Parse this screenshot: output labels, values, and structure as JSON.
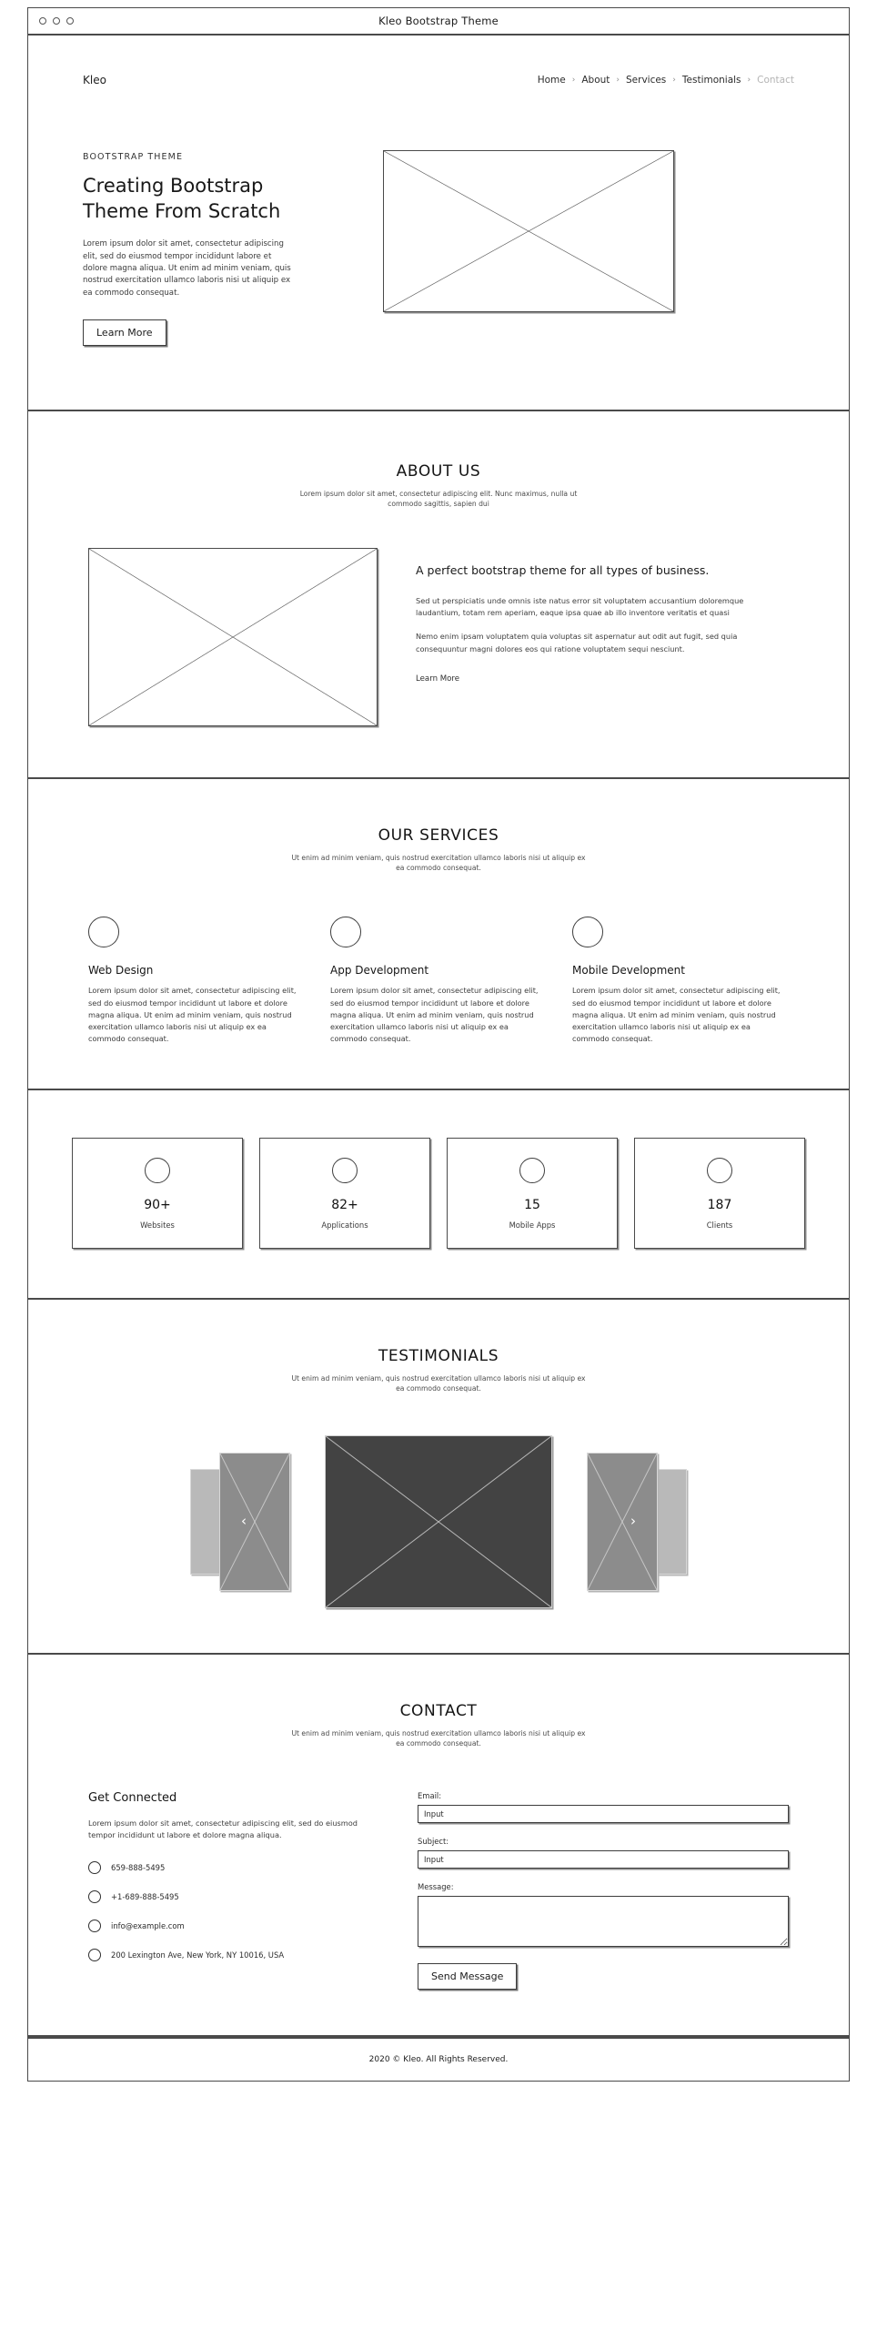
{
  "window": {
    "title": "Kleo Bootstrap Theme",
    "traffic_lights": [
      "close-dot",
      "minimize-dot",
      "maximize-dot"
    ]
  },
  "navbar": {
    "brand": "Kleo",
    "separator": "›",
    "links": [
      {
        "label": "Home",
        "muted": false
      },
      {
        "label": "About",
        "muted": false
      },
      {
        "label": "Services",
        "muted": false
      },
      {
        "label": "Testimonials",
        "muted": false
      },
      {
        "label": "Contact",
        "muted": true
      }
    ]
  },
  "hero": {
    "eyebrow": "BOOTSTRAP THEME",
    "title_line1": "Creating Bootstrap",
    "title_line2": "Theme From Scratch",
    "body": "Lorem ipsum dolor sit amet, consectetur adipiscing elit, sed do eiusmod tempor incididunt labore et dolore magna aliqua. Ut enim ad minim veniam, quis nostrud exercitation ullamco laboris nisi ut aliquip ex ea commodo consequat.",
    "cta_label": "Learn More",
    "image_alt": "image-placeholder"
  },
  "about": {
    "title": "ABOUT US",
    "subtitle": "Lorem ipsum dolor sit amet, consectetur adipiscing elit. Nunc maximus, nulla ut commodo sagittis, sapien dui",
    "image_alt": "image-placeholder",
    "heading": "A perfect bootstrap theme for all types of business.",
    "paragraph1": "Sed ut perspiciatis unde omnis iste natus error sit voluptatem accusantium doloremque laudantium, totam rem aperiam, eaque ipsa quae ab illo inventore veritatis et quasi",
    "paragraph2": "Nemo enim ipsam voluptatem quia voluptas sit aspernatur aut odit aut fugit, sed quia consequuntur magni dolores eos qui ratione voluptatem sequi nesciunt.",
    "link_label": "Learn More"
  },
  "services": {
    "title": "OUR SERVICES",
    "subtitle": "Ut enim ad minim veniam, quis nostrud exercitation ullamco laboris nisi ut aliquip ex ea commodo consequat.",
    "items": [
      {
        "icon": "circle-icon",
        "title": "Web Design",
        "text": "Lorem ipsum dolor sit amet, consectetur adipiscing elit, sed do eiusmod tempor incididunt ut labore et dolore magna aliqua. Ut enim ad minim veniam, quis nostrud exercitation ullamco laboris nisi ut aliquip ex ea commodo consequat."
      },
      {
        "icon": "circle-icon",
        "title": "App Development",
        "text": "Lorem ipsum dolor sit amet, consectetur adipiscing elit, sed do eiusmod tempor incididunt ut labore et dolore magna aliqua. Ut enim ad minim veniam, quis nostrud exercitation ullamco laboris nisi ut aliquip ex ea commodo consequat."
      },
      {
        "icon": "circle-icon",
        "title": "Mobile Development",
        "text": "Lorem ipsum dolor sit amet, consectetur adipiscing elit, sed do eiusmod tempor incididunt ut labore et dolore magna aliqua. Ut enim ad minim veniam, quis nostrud exercitation ullamco laboris nisi ut aliquip ex ea commodo consequat."
      }
    ]
  },
  "stats": {
    "items": [
      {
        "icon": "circle-icon",
        "value": "90+",
        "label": "Websites"
      },
      {
        "icon": "circle-icon",
        "value": "82+",
        "label": "Applications"
      },
      {
        "icon": "circle-icon",
        "value": "15",
        "label": "Mobile Apps"
      },
      {
        "icon": "circle-icon",
        "value": "187",
        "label": "Clients"
      }
    ]
  },
  "testimonials": {
    "title": "TESTIMONIALS",
    "subtitle": "Ut enim ad minim veniam, quis nostrud exercitation ullamco laboris nisi ut aliquip ex ea commodo consequat.",
    "prev_arrow": "‹",
    "next_arrow": "›",
    "slide_alt": "image-placeholder"
  },
  "contact": {
    "title": "CONTACT",
    "subtitle": "Ut enim ad minim veniam, quis nostrud exercitation ullamco laboris nisi ut aliquip ex ea commodo consequat.",
    "heading": "Get Connected",
    "paragraph": "Lorem ipsum dolor sit amet, consectetur adipiscing elit, sed do eiusmod tempor incididunt ut labore et dolore magna aliqua.",
    "details": [
      {
        "icon": "circle-icon",
        "value": "659-888-5495"
      },
      {
        "icon": "circle-icon",
        "value": "+1-689-888-5495"
      },
      {
        "icon": "circle-icon",
        "value": "info@example.com"
      },
      {
        "icon": "circle-icon",
        "value": "200 Lexington Ave, New York, NY 10016, USA"
      }
    ],
    "form": {
      "email_label": "Email:",
      "email_value": "Input",
      "subject_label": "Subject:",
      "subject_value": "Input",
      "message_label": "Message:",
      "message_value": "",
      "submit_label": "Send Message"
    }
  },
  "footer": {
    "text": "2020 © Kleo. All Rights Reserved."
  },
  "colors": {
    "line": "#4a4a4a",
    "shadow": "#8c8c8c",
    "muted_nav": "#b4b4b4",
    "slide_center": "#434343",
    "slide_near": "#8c8c8c",
    "slide_far": "#b9b9b9"
  }
}
